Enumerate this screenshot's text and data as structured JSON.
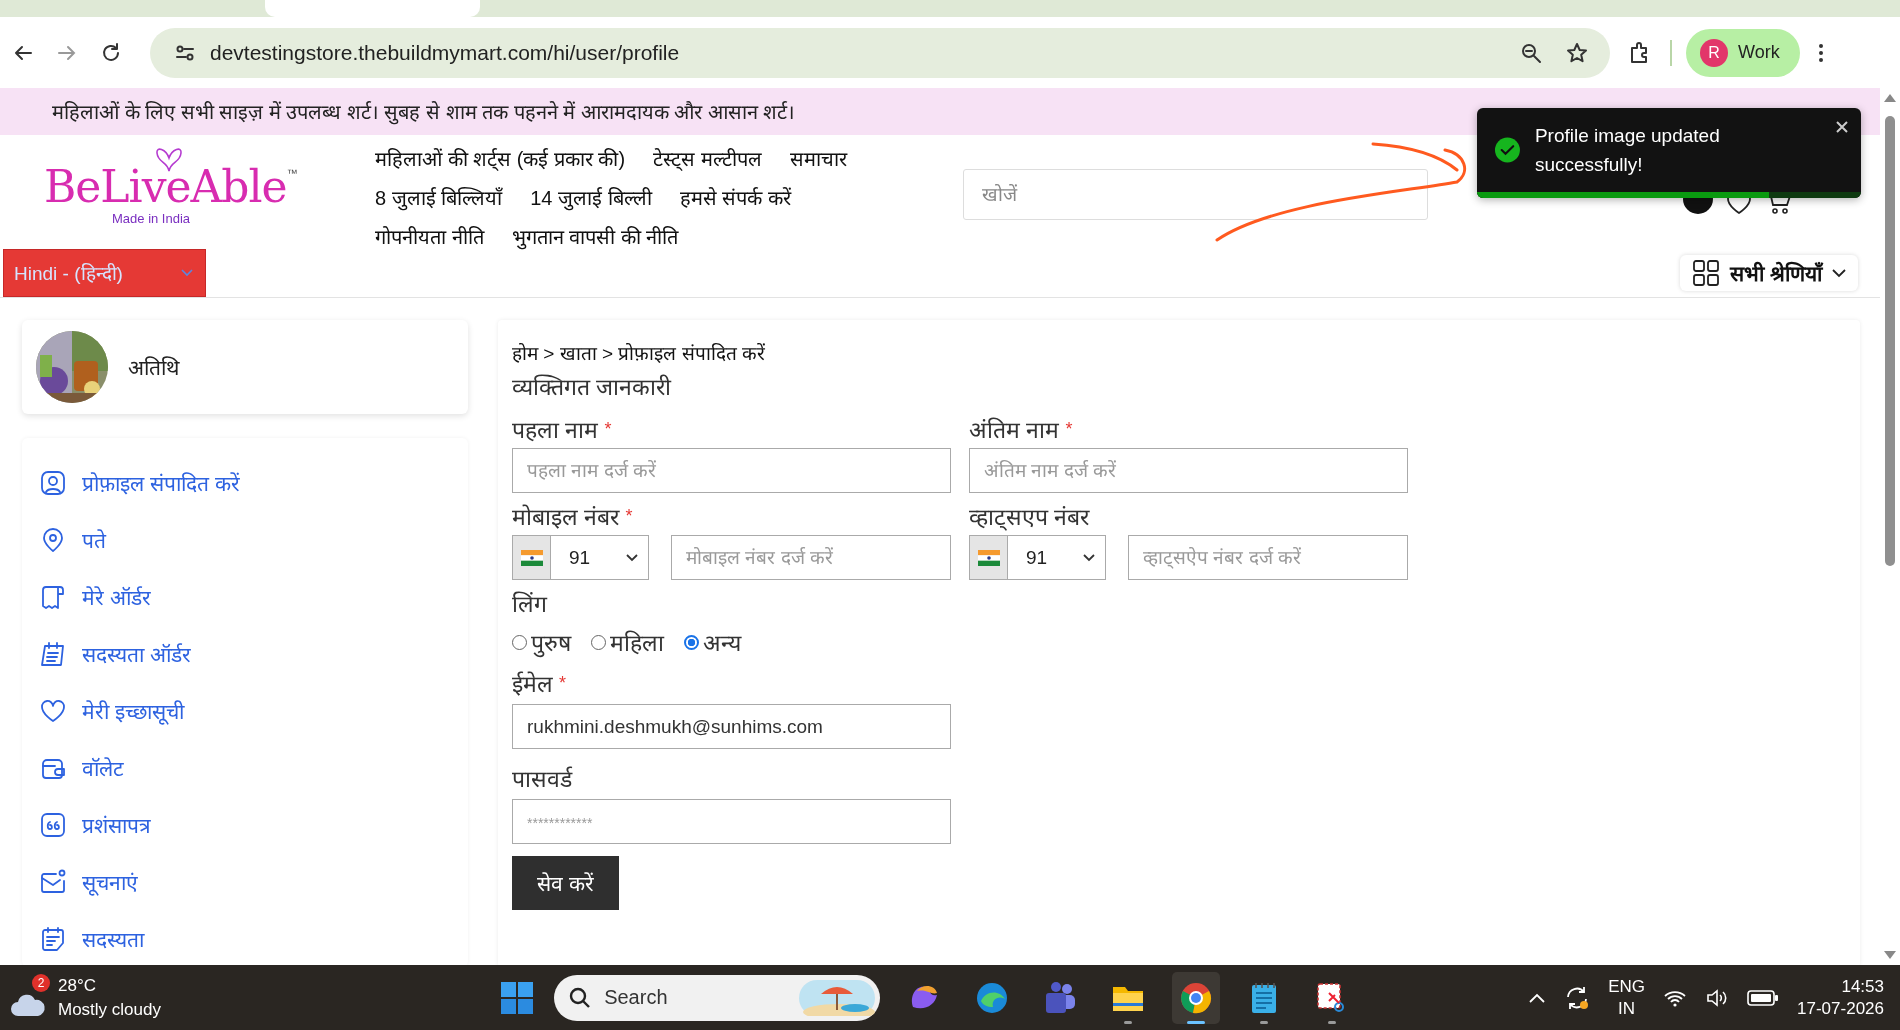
{
  "browser": {
    "url": "devtestingstore.thebuildmymart.com/hi/user/profile",
    "profile": {
      "initial": "R",
      "label": "Work"
    }
  },
  "announcement": "महिलाओं के लिए सभी साइज़ में उपलब्ध शर्ट। सुबह से शाम तक पहनने में आरामदायक और आसान शर्ट।",
  "logo": {
    "name": "BeLiveAble",
    "trademark": "™",
    "tagline": "Made in India"
  },
  "nav_rows": [
    [
      "महिलाओं की शर्ट्स (कई प्रकार की)",
      "टेस्ट्स मल्टीपल",
      "समाचार"
    ],
    [
      "8 जुलाई बिल्लियाँ",
      "14 जुलाई बिल्ली",
      "हमसे संपर्क करें"
    ],
    [
      "गोपनीयता नीति",
      "भुगतान वापसी की नीति"
    ]
  ],
  "search": {
    "placeholder": "खोजें"
  },
  "language": "Hindi - (हिन्दी)",
  "categories": "सभी श्रेणियाँ",
  "toast": {
    "message": "Profile image updated successfully!",
    "level": 0.76
  },
  "profile": {
    "name": "अतिथि"
  },
  "menu": [
    {
      "kind": "profile",
      "label": "प्रोफ़ाइल संपादित करें"
    },
    {
      "kind": "location",
      "label": "पते"
    },
    {
      "kind": "receipt",
      "label": "मेरे ऑर्डर"
    },
    {
      "kind": "calendar",
      "label": "सदस्यता ऑर्डर"
    },
    {
      "kind": "heart",
      "label": "मेरी इच्छासूची"
    },
    {
      "kind": "wallet",
      "label": "वॉलेट"
    },
    {
      "kind": "quote",
      "label": "प्रशंसापत्र"
    },
    {
      "kind": "mail",
      "label": "सूचनाएं"
    },
    {
      "kind": "note",
      "label": "सदस्यता"
    }
  ],
  "breadcrumb": "होम > खाता > प्रोफ़ाइल संपादित करें",
  "section_title": "व्यक्तिगत जानकारी",
  "fields": [
    {
      "kind": "text",
      "label": "पहला नाम",
      "required_mark": "*",
      "placeholder": "पहला नाम दर्ज करें"
    },
    {
      "kind": "text",
      "label": "अंतिम नाम",
      "required_mark": "*",
      "placeholder": "अंतिम नाम दर्ज करें"
    },
    {
      "kind": "phone",
      "label": "मोबाइल नंबर",
      "required_mark": "*",
      "code": "91",
      "placeholder": "मोबाइल नंबर दर्ज करें"
    },
    {
      "kind": "phone",
      "label": "व्हाट्सएप नंबर",
      "code": "91",
      "placeholder": "व्हाट्सऐप नंबर दर्ज करें"
    }
  ],
  "gender": {
    "label": "लिंग",
    "options": [
      {
        "label": "पुरुष",
        "selected": false
      },
      {
        "label": "महिला",
        "selected": false
      },
      {
        "label": "अन्य",
        "selected": true
      }
    ]
  },
  "email": {
    "label": "ईमेल",
    "required_mark": "*",
    "value": "rukhmini.deshmukh@sunhims.com"
  },
  "password": {
    "label": "पासवर्ड",
    "placeholder": "************"
  },
  "save_button": "सेव करें",
  "taskbar": {
    "weather": {
      "badge": "2",
      "temperature": "28°C",
      "condition": "Mostly cloudy"
    },
    "search": {
      "placeholder": "Search"
    },
    "apps": [
      {
        "kind": "swirl",
        "running": false,
        "selected": false
      },
      {
        "kind": "wave",
        "running": false,
        "selected": false
      },
      {
        "kind": "people",
        "running": false,
        "selected": false
      },
      {
        "kind": "folder",
        "running": true,
        "selected": false
      },
      {
        "kind": "browser",
        "running": true,
        "selected": true
      },
      {
        "kind": "notepad",
        "running": true,
        "selected": false
      },
      {
        "kind": "scissors",
        "running": true,
        "selected": false
      }
    ],
    "language": "ENG",
    "region": "IN",
    "time": "14:53",
    "date": "17-07-2026"
  }
}
